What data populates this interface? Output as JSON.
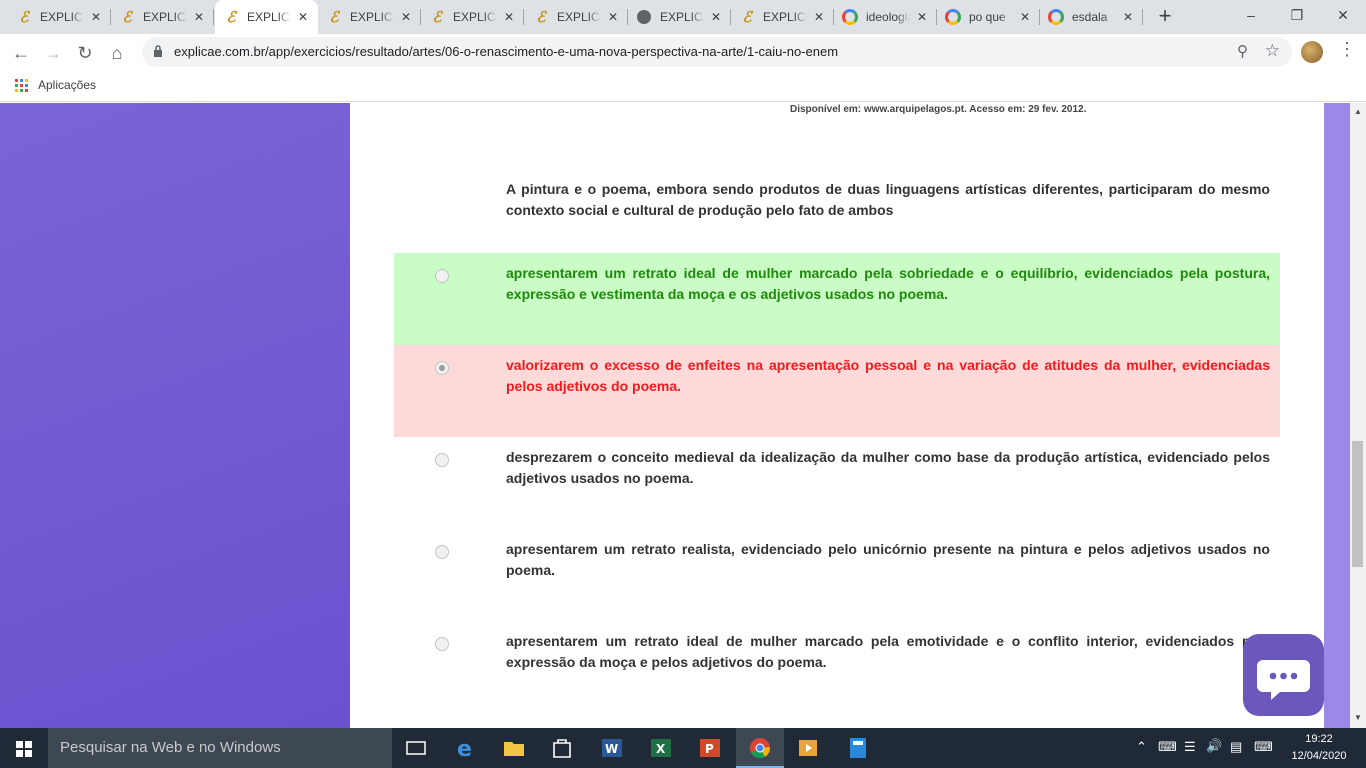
{
  "browser": {
    "tabs": [
      {
        "title": "EXPLICAE",
        "favicon": "explicae-icon",
        "active": false
      },
      {
        "title": "EXPLICAE",
        "favicon": "explicae-icon",
        "active": false
      },
      {
        "title": "EXPLICAE",
        "favicon": "explicae-icon",
        "active": true
      },
      {
        "title": "EXPLICAE",
        "favicon": "explicae-icon",
        "active": false
      },
      {
        "title": "EXPLICAE",
        "favicon": "explicae-icon",
        "active": false
      },
      {
        "title": "EXPLICAE",
        "favicon": "explicae-icon",
        "active": false
      },
      {
        "title": "EXPLICAE",
        "favicon": "globe-icon",
        "active": false
      },
      {
        "title": "EXPLICAE",
        "favicon": "explicae-icon",
        "active": false
      },
      {
        "title": "ideologia",
        "favicon": "google-icon",
        "active": false
      },
      {
        "title": "po que",
        "favicon": "google-icon",
        "active": false
      },
      {
        "title": "esdala",
        "favicon": "google-icon",
        "active": false
      }
    ],
    "url": "explicae.com.br/app/exercicios/resultado/artes/06-o-renascimento-e-uma-nova-perspectiva-na-arte/1-caiu-no-enem",
    "bookmarks": {
      "apps_label": "Aplicações"
    }
  },
  "page": {
    "source": "Disponível em: www.arquipelagos.pt. Acesso em: 29 fev. 2012.",
    "question": "A pintura e o poema, embora sendo produtos de duas linguagens artísticas diferentes, participaram do mesmo contexto social e cultural de produção pelo fato de ambos",
    "options": [
      {
        "text": "apresentarem um retrato ideal de mulher marcado pela sobriedade e o equilíbrio, evidenciados pela postura, expressão e vestimenta da moça e os adjetivos usados no poema.",
        "state": "correct",
        "selected": false
      },
      {
        "text": "valorizarem o excesso de enfeites na apresentação pessoal e na variação de atitudes da mulher, evidenciadas pelos adjetivos do poema.",
        "state": "wrong",
        "selected": true
      },
      {
        "text": "desprezarem o conceito medieval da idealização da mulher como base da produção artística, evidenciado pelos adjetivos usados no poema.",
        "state": "neutral",
        "selected": false
      },
      {
        "text": "apresentarem um retrato realista, evidenciado pelo unicórnio presente na pintura e pelos adjetivos usados no poema.",
        "state": "neutral",
        "selected": false
      },
      {
        "text": "apresentarem um retrato ideal de mulher marcado pela emotividade e o conflito interior, evidenciados pela expressão da moça e pelos adjetivos do poema.",
        "state": "neutral",
        "selected": false
      }
    ]
  },
  "colors": {
    "purple_panel": "#6a51cf",
    "correct_bg": "#c9fdc5",
    "wrong_bg": "#fddada",
    "correct_text": "#1e8a0b",
    "wrong_text": "#f21a1a"
  },
  "taskbar": {
    "search_placeholder": "Pesquisar na Web e no Windows",
    "time": "19:22",
    "date": "12/04/2020"
  }
}
